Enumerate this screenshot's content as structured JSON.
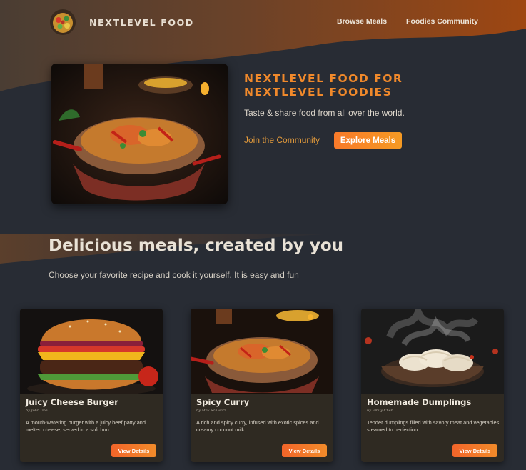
{
  "header": {
    "logo_text": "NEXTLEVEL FOOD",
    "nav": [
      {
        "label": "Browse Meals"
      },
      {
        "label": "Foodies Community"
      }
    ]
  },
  "hero": {
    "title": "NEXTLEVEL FOOD FOR NEXTLEVEL FOODIES",
    "subtitle": "Taste & share food from all over the world.",
    "link_label": "Join the Community",
    "button_label": "Explore Meals"
  },
  "section": {
    "title": "Delicious meals, created by you",
    "subtitle": "Choose your favorite recipe and cook it yourself. It is easy and fun"
  },
  "meals": [
    {
      "title": "Juicy Cheese Burger",
      "author": "by John Doe",
      "description": "A mouth-watering burger with a juicy beef patty and melted cheese, served in a soft bun.",
      "button_label": "View Details"
    },
    {
      "title": "Spicy Curry",
      "author": "by Max Schwarz",
      "description": "A rich and spicy curry, infused with exotic spices and creamy coconut milk.",
      "button_label": "View Details"
    },
    {
      "title": "Homemade Dumplings",
      "author": "by Emily Chen",
      "description": "Tender dumplings filled with savory meat and vegetables, steamed to perfection.",
      "button_label": "View Details"
    }
  ],
  "colors": {
    "background": "#282c34",
    "accent_orange": "#f0892b",
    "button_gradient_start": "#f97a2a",
    "button_gradient_end": "#f59a23",
    "card_background": "#2f2a22"
  },
  "icons": {
    "logo": "food-plate-logo"
  }
}
